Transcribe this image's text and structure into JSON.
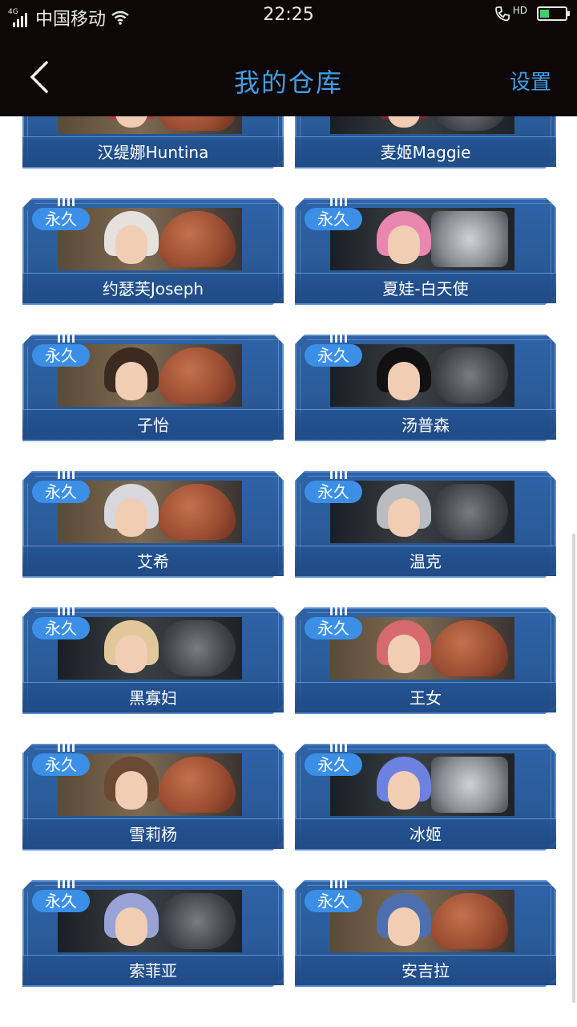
{
  "status_bar": {
    "network": "4G",
    "carrier": "中国移动",
    "time": "22:25",
    "hd_label": "HD",
    "battery_level": 0.35
  },
  "header": {
    "title": "我的仓库",
    "settings_label": "设置",
    "back_icon": "chevron-left-icon"
  },
  "badge_label": "永久",
  "colors": {
    "accent": "#3f9ee6",
    "card_blue": "#2f63a6",
    "badge_blue": "#3b8fe6"
  },
  "items": [
    {
      "name": "汉缇娜Huntina",
      "badge": "",
      "emblem": "fist",
      "hair": "#b33a4a",
      "bg": "warm"
    },
    {
      "name": "麦姬Maggie",
      "badge": "",
      "emblem": "wreath",
      "hair": "#7a2a2a",
      "bg": "dark"
    },
    {
      "name": "约瑟芙Joseph",
      "badge": "永久",
      "emblem": "fist",
      "hair": "#e5e1dd",
      "bg": "warm"
    },
    {
      "name": "夏娃-白天使",
      "badge": "永久",
      "emblem": "star",
      "hair": "#e987b1",
      "bg": "dark"
    },
    {
      "name": "子怡",
      "badge": "永久",
      "emblem": "fist",
      "hair": "#3a2a20",
      "bg": "warm"
    },
    {
      "name": "汤普森",
      "badge": "永久",
      "emblem": "wreath",
      "hair": "#111111",
      "bg": "dark"
    },
    {
      "name": "艾希",
      "badge": "永久",
      "emblem": "fist",
      "hair": "#d8d8dc",
      "bg": "warm"
    },
    {
      "name": "温克",
      "badge": "永久",
      "emblem": "wreath",
      "hair": "#b9bcc1",
      "bg": "dark"
    },
    {
      "name": "黑寡妇",
      "badge": "永久",
      "emblem": "wreath",
      "hair": "#e2c79a",
      "bg": "dark"
    },
    {
      "name": "王女",
      "badge": "永久",
      "emblem": "fist",
      "hair": "#d66a6f",
      "bg": "warm"
    },
    {
      "name": "雪莉杨",
      "badge": "永久",
      "emblem": "fist",
      "hair": "#6b4a33",
      "bg": "warm"
    },
    {
      "name": "冰姬",
      "badge": "永久",
      "emblem": "star",
      "hair": "#6d82e0",
      "bg": "dark"
    },
    {
      "name": "索菲亚",
      "badge": "永久",
      "emblem": "wreath",
      "hair": "#9aa3d8",
      "bg": "dark"
    },
    {
      "name": "安吉拉",
      "badge": "永久",
      "emblem": "fist",
      "hair": "#4d6fb0",
      "bg": "warm"
    }
  ]
}
